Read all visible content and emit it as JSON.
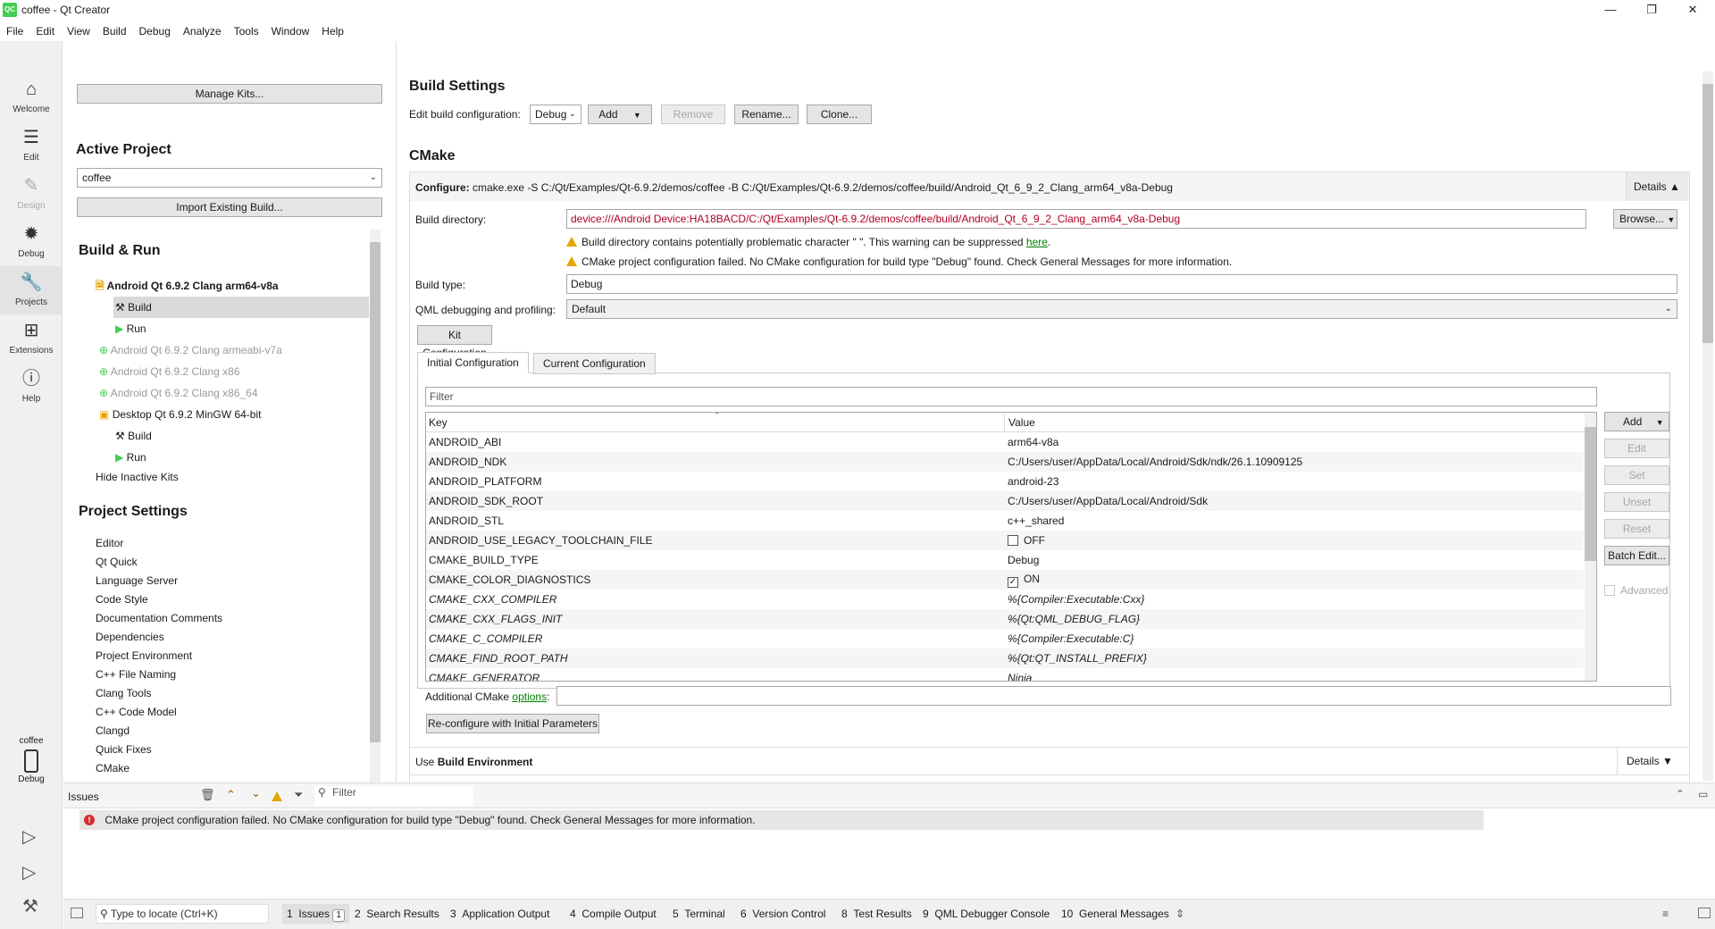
{
  "window": {
    "title": "coffee - Qt Creator",
    "logo_text": "QC",
    "minimize": "—",
    "maximize": "❐",
    "close": "✕"
  },
  "menu": [
    "File",
    "Edit",
    "View",
    "Build",
    "Debug",
    "Analyze",
    "Tools",
    "Window",
    "Help"
  ],
  "modes": {
    "welcome": "Welcome",
    "edit": "Edit",
    "design": "Design",
    "debug": "Debug",
    "projects": "Projects",
    "extensions": "Extensions",
    "help": "Help",
    "target_project": "coffee",
    "target_config": "Debug"
  },
  "left": {
    "manage_kits": "Manage Kits...",
    "active_project_heading": "Active Project",
    "active_project_value": "coffee",
    "import_build": "Import Existing Build...",
    "build_run_heading": "Build & Run",
    "kits": [
      {
        "label": "Android Qt 6.9.2 Clang arm64-v8a"
      },
      {
        "label": "Build"
      },
      {
        "label": "Run"
      },
      {
        "label": "Android Qt 6.9.2 Clang armeabi-v7a"
      },
      {
        "label": "Android Qt 6.9.2 Clang x86"
      },
      {
        "label": "Android Qt 6.9.2 Clang x86_64"
      },
      {
        "label": "Desktop Qt 6.9.2 MinGW 64-bit"
      },
      {
        "label": "Build"
      },
      {
        "label": "Run"
      }
    ],
    "hide_inactive": "Hide Inactive Kits",
    "project_settings_heading": "Project Settings",
    "project_settings": [
      "Editor",
      "Qt Quick",
      "Language Server",
      "Code Style",
      "Documentation Comments",
      "Dependencies",
      "Project Environment",
      "C++ File Naming",
      "Clang Tools",
      "C++ Code Model",
      "Clangd",
      "Quick Fixes",
      "CMake"
    ]
  },
  "main": {
    "build_settings_heading": "Build Settings",
    "edit_config_label": "Edit build configuration:",
    "config_value": "Debug",
    "add": "Add",
    "remove": "Remove",
    "rename": "Rename...",
    "clone": "Clone...",
    "cmake_heading": "CMake",
    "configure_label": "Configure:",
    "configure_cmd": "cmake.exe -S C:/Qt/Examples/Qt-6.9.2/demos/coffee -B C:/Qt/Examples/Qt-6.9.2/demos/coffee/build/Android_Qt_6_9_2_Clang_arm64_v8a-Debug",
    "details": "Details",
    "build_dir_label": "Build directory:",
    "build_dir_value": "device:///Android Device:HA18BACD/C:/Qt/Examples/Qt-6.9.2/demos/coffee/build/Android_Qt_6_9_2_Clang_arm64_v8a-Debug",
    "browse": "Browse...",
    "warning1": "Build directory contains potentially problematic character \" \". This warning can be suppressed ",
    "warning1_link": "here",
    "warning1_end": ".",
    "warning2": "CMake project configuration failed. No CMake configuration for build type \"Debug\" found. Check General Messages for more information.",
    "build_type_label": "Build type:",
    "build_type_value": "Debug",
    "qml_label": "QML debugging and profiling:",
    "qml_value": "Default",
    "kit_config": "Kit Configuration",
    "tab_initial": "Initial Configuration",
    "tab_current": "Current Configuration",
    "filter_placeholder": "Filter",
    "col_key": "Key",
    "col_value": "Value",
    "rows": [
      {
        "key": "ANDROID_ABI",
        "value": "arm64-v8a"
      },
      {
        "key": "ANDROID_NDK",
        "value": "C:/Users/user/AppData/Local/Android/Sdk/ndk/26.1.10909125"
      },
      {
        "key": "ANDROID_PLATFORM",
        "value": "android-23"
      },
      {
        "key": "ANDROID_SDK_ROOT",
        "value": "C:/Users/user/AppData/Local/Android/Sdk"
      },
      {
        "key": "ANDROID_STL",
        "value": "c++_shared"
      },
      {
        "key": "ANDROID_USE_LEGACY_TOOLCHAIN_FILE",
        "value": "OFF"
      },
      {
        "key": "CMAKE_BUILD_TYPE",
        "value": "Debug"
      },
      {
        "key": "CMAKE_COLOR_DIAGNOSTICS",
        "value": "ON"
      },
      {
        "key": "CMAKE_CXX_COMPILER",
        "value": "%{Compiler:Executable:Cxx}"
      },
      {
        "key": "CMAKE_CXX_FLAGS_INIT",
        "value": "%{Qt:QML_DEBUG_FLAG}"
      },
      {
        "key": "CMAKE_C_COMPILER",
        "value": "%{Compiler:Executable:C}"
      },
      {
        "key": "CMAKE_FIND_ROOT_PATH",
        "value": "%{Qt:QT_INSTALL_PREFIX}"
      },
      {
        "key": "CMAKE_GENERATOR",
        "value": "Ninja"
      }
    ],
    "side_add": "Add",
    "side_edit": "Edit",
    "side_set": "Set",
    "side_unset": "Unset",
    "side_reset": "Reset",
    "side_batch": "Batch Edit...",
    "advanced": "Advanced",
    "additional_label": "Additional CMake ",
    "additional_link": "options",
    "additional_colon": ":",
    "reconfigure": "Re-configure with Initial Parameters",
    "use_label": "Use ",
    "use_bold": "Build Environment",
    "details2": "Details"
  },
  "issues": {
    "title": "Issues",
    "filter_placeholder": "Filter",
    "message": "CMake project configuration failed. No CMake configuration for build type \"Debug\" found. Check General Messages for more information."
  },
  "status": {
    "locate_placeholder": "Type to locate (Ctrl+K)",
    "tabs": [
      {
        "num": "1",
        "label": "Issues",
        "badge": "1"
      },
      {
        "num": "2",
        "label": "Search Results"
      },
      {
        "num": "3",
        "label": "Application Output"
      },
      {
        "num": "4",
        "label": "Compile Output"
      },
      {
        "num": "5",
        "label": "Terminal"
      },
      {
        "num": "6",
        "label": "Version Control"
      },
      {
        "num": "8",
        "label": "Test Results"
      },
      {
        "num": "9",
        "label": "QML Debugger Console"
      },
      {
        "num": "10",
        "label": "General Messages"
      }
    ]
  },
  "colors": {
    "accent_green": "#41cd52",
    "error_red": "#d32f2f",
    "warning_yellow": "#e5a400",
    "path_red": "#b00020"
  }
}
